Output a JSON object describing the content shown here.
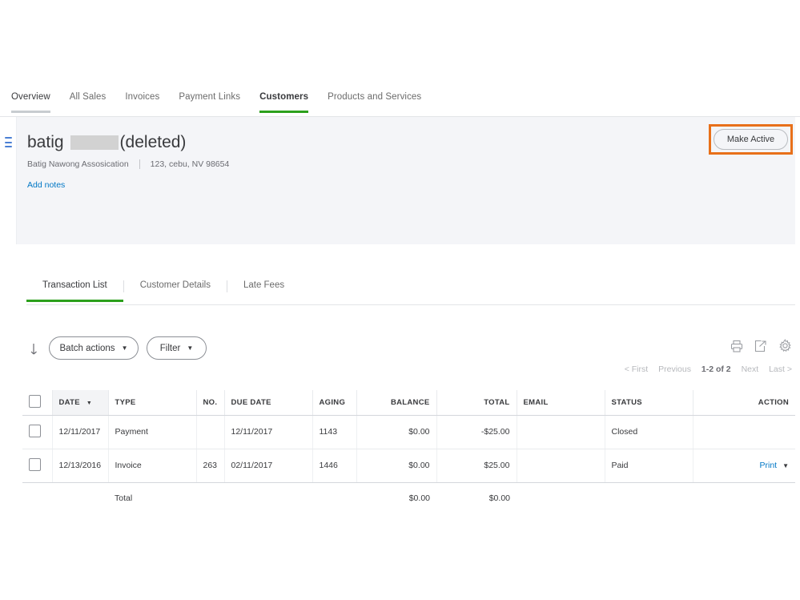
{
  "topnav": {
    "items": [
      {
        "label": "Overview",
        "state": "firstmark"
      },
      {
        "label": "All Sales",
        "state": "normal"
      },
      {
        "label": "Invoices",
        "state": "normal"
      },
      {
        "label": "Payment Links",
        "state": "normal"
      },
      {
        "label": "Customers",
        "state": "active"
      },
      {
        "label": "Products and Services",
        "state": "normal"
      }
    ]
  },
  "customer": {
    "name_prefix": "batig",
    "name_suffix": "(deleted)",
    "company": "Batig Nawong Assosication",
    "address": "123, cebu, NV 98654",
    "add_notes_label": "Add notes",
    "make_active_label": "Make Active",
    "highlight_color": "#e8701a",
    "grip_icon": "drag-handle-icon"
  },
  "subtabs": {
    "items": [
      {
        "label": "Transaction List",
        "active": true
      },
      {
        "label": "Customer Details",
        "active": false
      },
      {
        "label": "Late Fees",
        "active": false
      }
    ]
  },
  "toolbar": {
    "batch_actions_label": "Batch actions",
    "filter_label": "Filter",
    "caret": "▼",
    "icons": [
      "print-icon",
      "export-icon",
      "gear-icon"
    ],
    "download_arrow_icon": "download-arrow-icon"
  },
  "pagination": {
    "first": "< First",
    "previous": "Previous",
    "current": "1-2 of 2",
    "next": "Next",
    "last": "Last >"
  },
  "table": {
    "columns": [
      {
        "key": "checkbox",
        "label": ""
      },
      {
        "key": "date",
        "label": "DATE",
        "sorted": true,
        "sort_caret": "▼"
      },
      {
        "key": "type",
        "label": "TYPE"
      },
      {
        "key": "no",
        "label": "NO."
      },
      {
        "key": "due_date",
        "label": "DUE DATE"
      },
      {
        "key": "aging",
        "label": "AGING"
      },
      {
        "key": "balance",
        "label": "BALANCE"
      },
      {
        "key": "total",
        "label": "TOTAL"
      },
      {
        "key": "email",
        "label": "EMAIL"
      },
      {
        "key": "status",
        "label": "STATUS"
      },
      {
        "key": "action",
        "label": "ACTION"
      }
    ],
    "rows": [
      {
        "date": "12/11/2017",
        "type": "Payment",
        "no": "",
        "due_date": "12/11/2017",
        "aging": "1143",
        "balance": "$0.00",
        "total": "-$25.00",
        "email": "",
        "status": "Closed",
        "action": ""
      },
      {
        "date": "12/13/2016",
        "type": "Invoice",
        "no": "263",
        "due_date": "02/11/2017",
        "aging": "1446",
        "balance": "$0.00",
        "total": "$25.00",
        "email": "",
        "status": "Paid",
        "action": "Print"
      }
    ],
    "total_row": {
      "label": "Total",
      "balance": "$0.00",
      "total": "$0.00"
    },
    "action_caret": "▼"
  }
}
